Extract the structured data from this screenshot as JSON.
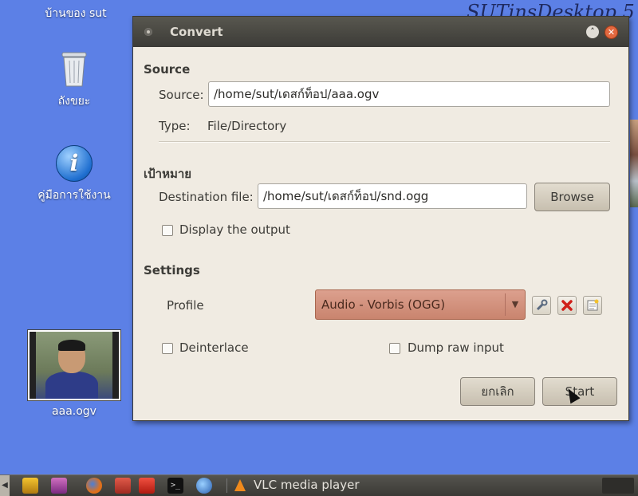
{
  "desktop": {
    "banner": "SUTinsDesktop 5",
    "home_label": "บ้านของ sut",
    "trash_label": "ถังขยะ",
    "help_label": "คู่มือการใช้งาน",
    "video_label": "aaa.ogv"
  },
  "dialog": {
    "title": "Convert",
    "source": {
      "heading": "Source",
      "source_label": "Source:",
      "source_value": "/home/sut/เดสก์ท็อป/aaa.ogv",
      "type_label": "Type:",
      "type_value": "File/Directory"
    },
    "destination": {
      "heading": "เป้าหมาย",
      "dest_label": "Destination file:",
      "dest_value": "/home/sut/เดสก์ท็อป/snd.ogg",
      "browse_label": "Browse",
      "display_output_label": "Display the output",
      "display_output_checked": false
    },
    "settings": {
      "heading": "Settings",
      "profile_label": "Profile",
      "profile_value": "Audio - Vorbis (OGG)",
      "deinterlace_label": "Deinterlace",
      "deinterlace_checked": false,
      "dump_raw_label": "Dump raw input",
      "dump_raw_checked": false
    },
    "cancel_label": "ยกเลิก",
    "start_label": "Start"
  },
  "taskbar": {
    "active_task": "VLC media player"
  },
  "colors": {
    "desktop_bg": "#5c80e6",
    "dialog_bg": "#f0ebe2",
    "titlebar": "#3c3b37",
    "close_button": "#e2683f",
    "profile_combo": "#d3917c"
  },
  "icons": [
    "trash-icon",
    "info-icon",
    "video-file-icon",
    "edit-profile-icon",
    "delete-profile-icon",
    "new-profile-icon",
    "window-close-icon",
    "window-minimize-icon"
  ]
}
